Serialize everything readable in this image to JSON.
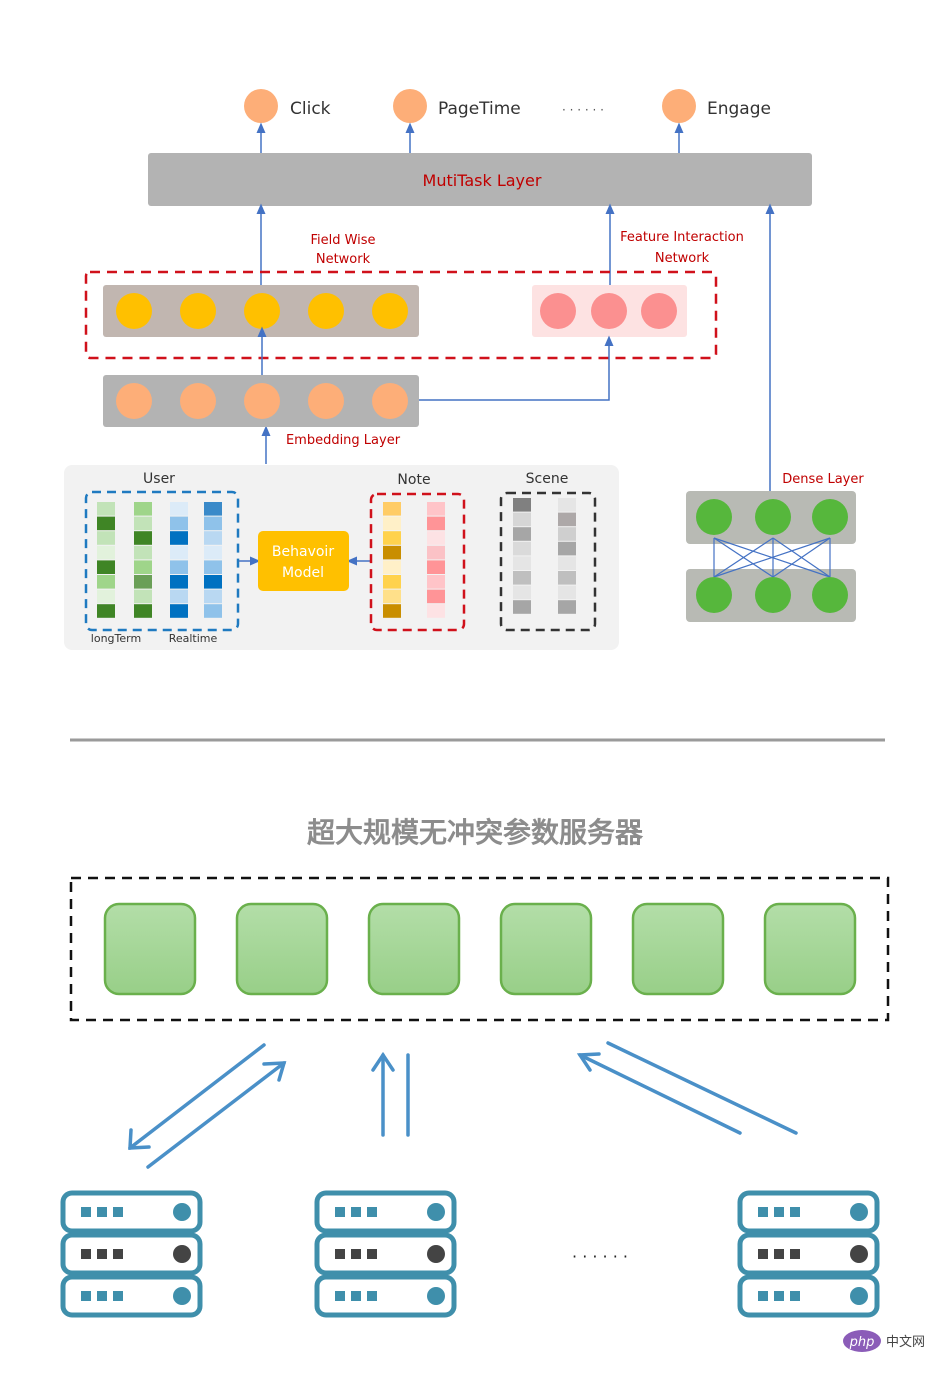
{
  "top_diagram": {
    "outputs": [
      {
        "label": "Click"
      },
      {
        "label": "PageTime"
      },
      {
        "label": "Engage"
      }
    ],
    "outputs_ellipsis": "· · · · · ·",
    "multitask_layer": "MutiTask  Layer",
    "field_wise_network": [
      "Field  Wise",
      "Network"
    ],
    "feature_interaction_network": [
      "Feature  Interaction",
      "Network"
    ],
    "embedding_layer": "Embedding  Layer",
    "dense_layer": "Dense  Layer",
    "inputs": {
      "user": "User",
      "long_term": "longTerm",
      "realtime": "Realtime",
      "behavior_model": [
        "Behavoir",
        "Model"
      ],
      "note": "Note",
      "scene": "Scene"
    },
    "user_columns": [
      [
        "#c2e3b8",
        "#3f8525",
        "#c2e3b8",
        "#e2f2dc",
        "#3f8525",
        "#9fd58a",
        "#e2f2dc",
        "#3f8525"
      ],
      [
        "#9fd58a",
        "#c2e3b8",
        "#3f8525",
        "#c2e3b8",
        "#9fd58a",
        "#6a9f57",
        "#c2e3b8",
        "#3f8525"
      ],
      [
        "#dcebf8",
        "#8fc2ea",
        "#0071c1",
        "#dcebf8",
        "#8fc2ea",
        "#0071c1",
        "#b9d8f2",
        "#0071c1"
      ],
      [
        "#3a8ac9",
        "#8fc2ea",
        "#b9d8f2",
        "#dcebf8",
        "#8fc2ea",
        "#0071c1",
        "#b9d8f2",
        "#8fc2ea"
      ]
    ],
    "note_columns": [
      [
        "#ffcc66",
        "#fff0c8",
        "#ffd24d",
        "#c98e00",
        "#fff0c8",
        "#ffd24d",
        "#ffe08a",
        "#c98e00"
      ],
      [
        "#ffc4c8",
        "#ff9497",
        "#fde2e4",
        "#fbc2c6",
        "#ff9497",
        "#ffc4c8",
        "#ff9497",
        "#fde2e4"
      ]
    ],
    "scene_columns": [
      [
        "#808080",
        "#d6d6d6",
        "#a6a6a6",
        "#dadada",
        "#e5e5e5",
        "#bfbfbf",
        "#e5e5e5",
        "#a6a6a6"
      ],
      [
        "#e5e5e5",
        "#ada8a8",
        "#cfcfcf",
        "#a6a6a6",
        "#e5e5e5",
        "#bfbfbf",
        "#e5e5e5",
        "#a6a6a6"
      ]
    ],
    "colors": {
      "output_node": "#fdae78",
      "field_node": "#ffc000",
      "embedding_node": "#fdae78",
      "interaction_node": "#fb9090",
      "dense_node": "#56b73c",
      "arrow": "#4472c4",
      "red_label": "#c00000"
    }
  },
  "bottom_diagram": {
    "title": "超大规模无冲突参数服务器",
    "param_blocks": 6,
    "servers": 3,
    "servers_ellipsis": "· · · · · ·",
    "colors": {
      "block_fill": "#a9d8a0",
      "block_stroke": "#6ab04c",
      "server": "#3f8fab",
      "server_dark": "#444444",
      "arrow": "#4a90c8"
    }
  },
  "watermark": {
    "badge": "php",
    "text": "中文网"
  }
}
